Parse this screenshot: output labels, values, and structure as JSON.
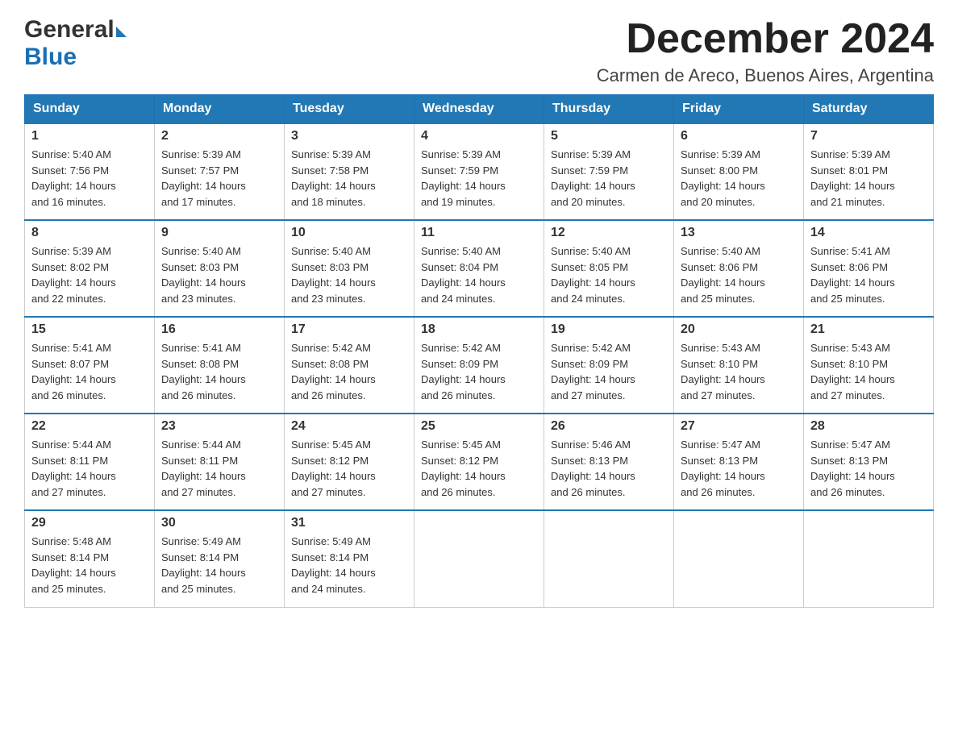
{
  "header": {
    "logo_general": "General",
    "logo_blue": "Blue",
    "month_title": "December 2024",
    "location": "Carmen de Areco, Buenos Aires, Argentina"
  },
  "days_of_week": [
    "Sunday",
    "Monday",
    "Tuesday",
    "Wednesday",
    "Thursday",
    "Friday",
    "Saturday"
  ],
  "weeks": [
    [
      {
        "day": "1",
        "sunrise": "5:40 AM",
        "sunset": "7:56 PM",
        "daylight": "14 hours and 16 minutes."
      },
      {
        "day": "2",
        "sunrise": "5:39 AM",
        "sunset": "7:57 PM",
        "daylight": "14 hours and 17 minutes."
      },
      {
        "day": "3",
        "sunrise": "5:39 AM",
        "sunset": "7:58 PM",
        "daylight": "14 hours and 18 minutes."
      },
      {
        "day": "4",
        "sunrise": "5:39 AM",
        "sunset": "7:59 PM",
        "daylight": "14 hours and 19 minutes."
      },
      {
        "day": "5",
        "sunrise": "5:39 AM",
        "sunset": "7:59 PM",
        "daylight": "14 hours and 20 minutes."
      },
      {
        "day": "6",
        "sunrise": "5:39 AM",
        "sunset": "8:00 PM",
        "daylight": "14 hours and 20 minutes."
      },
      {
        "day": "7",
        "sunrise": "5:39 AM",
        "sunset": "8:01 PM",
        "daylight": "14 hours and 21 minutes."
      }
    ],
    [
      {
        "day": "8",
        "sunrise": "5:39 AM",
        "sunset": "8:02 PM",
        "daylight": "14 hours and 22 minutes."
      },
      {
        "day": "9",
        "sunrise": "5:40 AM",
        "sunset": "8:03 PM",
        "daylight": "14 hours and 23 minutes."
      },
      {
        "day": "10",
        "sunrise": "5:40 AM",
        "sunset": "8:03 PM",
        "daylight": "14 hours and 23 minutes."
      },
      {
        "day": "11",
        "sunrise": "5:40 AM",
        "sunset": "8:04 PM",
        "daylight": "14 hours and 24 minutes."
      },
      {
        "day": "12",
        "sunrise": "5:40 AM",
        "sunset": "8:05 PM",
        "daylight": "14 hours and 24 minutes."
      },
      {
        "day": "13",
        "sunrise": "5:40 AM",
        "sunset": "8:06 PM",
        "daylight": "14 hours and 25 minutes."
      },
      {
        "day": "14",
        "sunrise": "5:41 AM",
        "sunset": "8:06 PM",
        "daylight": "14 hours and 25 minutes."
      }
    ],
    [
      {
        "day": "15",
        "sunrise": "5:41 AM",
        "sunset": "8:07 PM",
        "daylight": "14 hours and 26 minutes."
      },
      {
        "day": "16",
        "sunrise": "5:41 AM",
        "sunset": "8:08 PM",
        "daylight": "14 hours and 26 minutes."
      },
      {
        "day": "17",
        "sunrise": "5:42 AM",
        "sunset": "8:08 PM",
        "daylight": "14 hours and 26 minutes."
      },
      {
        "day": "18",
        "sunrise": "5:42 AM",
        "sunset": "8:09 PM",
        "daylight": "14 hours and 26 minutes."
      },
      {
        "day": "19",
        "sunrise": "5:42 AM",
        "sunset": "8:09 PM",
        "daylight": "14 hours and 27 minutes."
      },
      {
        "day": "20",
        "sunrise": "5:43 AM",
        "sunset": "8:10 PM",
        "daylight": "14 hours and 27 minutes."
      },
      {
        "day": "21",
        "sunrise": "5:43 AM",
        "sunset": "8:10 PM",
        "daylight": "14 hours and 27 minutes."
      }
    ],
    [
      {
        "day": "22",
        "sunrise": "5:44 AM",
        "sunset": "8:11 PM",
        "daylight": "14 hours and 27 minutes."
      },
      {
        "day": "23",
        "sunrise": "5:44 AM",
        "sunset": "8:11 PM",
        "daylight": "14 hours and 27 minutes."
      },
      {
        "day": "24",
        "sunrise": "5:45 AM",
        "sunset": "8:12 PM",
        "daylight": "14 hours and 27 minutes."
      },
      {
        "day": "25",
        "sunrise": "5:45 AM",
        "sunset": "8:12 PM",
        "daylight": "14 hours and 26 minutes."
      },
      {
        "day": "26",
        "sunrise": "5:46 AM",
        "sunset": "8:13 PM",
        "daylight": "14 hours and 26 minutes."
      },
      {
        "day": "27",
        "sunrise": "5:47 AM",
        "sunset": "8:13 PM",
        "daylight": "14 hours and 26 minutes."
      },
      {
        "day": "28",
        "sunrise": "5:47 AM",
        "sunset": "8:13 PM",
        "daylight": "14 hours and 26 minutes."
      }
    ],
    [
      {
        "day": "29",
        "sunrise": "5:48 AM",
        "sunset": "8:14 PM",
        "daylight": "14 hours and 25 minutes."
      },
      {
        "day": "30",
        "sunrise": "5:49 AM",
        "sunset": "8:14 PM",
        "daylight": "14 hours and 25 minutes."
      },
      {
        "day": "31",
        "sunrise": "5:49 AM",
        "sunset": "8:14 PM",
        "daylight": "14 hours and 24 minutes."
      },
      null,
      null,
      null,
      null
    ]
  ],
  "labels": {
    "sunrise": "Sunrise:",
    "sunset": "Sunset:",
    "daylight": "Daylight:"
  }
}
